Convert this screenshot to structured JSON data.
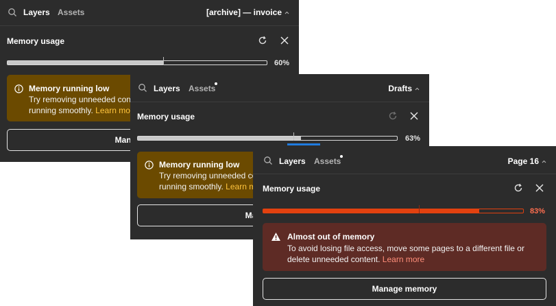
{
  "panels": [
    {
      "tabs": {
        "layers": "Layers",
        "assets": "Assets"
      },
      "page_label": "[archive] — invoice",
      "section_title": "Memory usage",
      "usage_percent_label": "60%",
      "usage_fraction": 0.6,
      "warning": {
        "title": "Memory running low",
        "line1": "Try removing unneeded content",
        "line2_text": "running smoothly.",
        "learn_more": "Learn more"
      },
      "manage_label": "Manage memory"
    },
    {
      "tabs": {
        "layers": "Layers",
        "assets": "Assets"
      },
      "page_label": "Drafts",
      "section_title": "Memory usage",
      "usage_percent_label": "63%",
      "usage_fraction": 0.63,
      "warning": {
        "title": "Memory running low",
        "line1": "Try removing unneeded content",
        "line2_text": "running smoothly.",
        "learn_more": "Learn more"
      },
      "manage_label": "Manage memory"
    },
    {
      "tabs": {
        "layers": "Layers",
        "assets": "Assets"
      },
      "page_label": "Page 16",
      "section_title": "Memory usage",
      "usage_percent_label": "83%",
      "usage_fraction": 0.83,
      "alert": {
        "title": "Almost out of memory",
        "line1": "To avoid losing file access, move some pages to a different file or",
        "line2_text": "delete unneeded content.",
        "learn_more": "Learn more"
      },
      "manage_label": "Manage memory"
    }
  ],
  "colors": {
    "panel_bg": "#2c2c2c",
    "warning_bg": "#6b4a00",
    "danger_bg": "#5e2b25",
    "danger_bar": "#e2410f",
    "learn_more_warning": "#ffc43d",
    "learn_more_danger": "#ff8e7a",
    "focus_blue": "#1f7be0"
  }
}
